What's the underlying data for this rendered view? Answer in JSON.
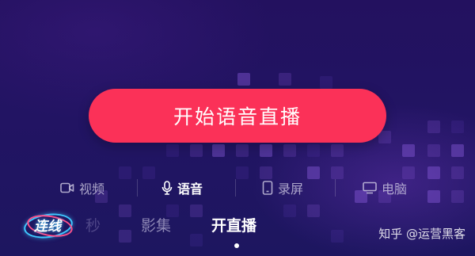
{
  "main": {
    "start_button_label": "开始语音直播"
  },
  "modes": [
    {
      "label": "视频",
      "icon": "video-camera-icon",
      "active": false
    },
    {
      "label": "语音",
      "icon": "microphone-icon",
      "active": true
    },
    {
      "label": "录屏",
      "icon": "phone-screen-icon",
      "active": false
    },
    {
      "label": "电脑",
      "icon": "monitor-icon",
      "active": false
    }
  ],
  "tabs": {
    "lianxian_label": "连线",
    "items": [
      {
        "label": "秒"
      },
      {
        "label": "影集"
      },
      {
        "label": "开直播",
        "active": true
      }
    ]
  },
  "watermark": "知乎 @运营黑客",
  "colors": {
    "background": "#221463",
    "button": "#fb3158",
    "accent_ring_blue": "#3fc8ff",
    "accent_ring_pink": "#ff4f8a"
  }
}
